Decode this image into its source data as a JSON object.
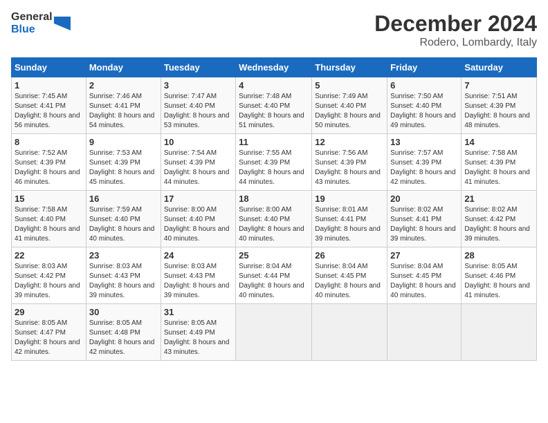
{
  "logo": {
    "line1": "General",
    "line2": "Blue"
  },
  "title": "December 2024",
  "location": "Rodero, Lombardy, Italy",
  "days_of_week": [
    "Sunday",
    "Monday",
    "Tuesday",
    "Wednesday",
    "Thursday",
    "Friday",
    "Saturday"
  ],
  "weeks": [
    [
      {
        "day": "1",
        "sunrise": "7:45 AM",
        "sunset": "4:41 PM",
        "daylight": "8 hours and 56 minutes."
      },
      {
        "day": "2",
        "sunrise": "7:46 AM",
        "sunset": "4:41 PM",
        "daylight": "8 hours and 54 minutes."
      },
      {
        "day": "3",
        "sunrise": "7:47 AM",
        "sunset": "4:40 PM",
        "daylight": "8 hours and 53 minutes."
      },
      {
        "day": "4",
        "sunrise": "7:48 AM",
        "sunset": "4:40 PM",
        "daylight": "8 hours and 51 minutes."
      },
      {
        "day": "5",
        "sunrise": "7:49 AM",
        "sunset": "4:40 PM",
        "daylight": "8 hours and 50 minutes."
      },
      {
        "day": "6",
        "sunrise": "7:50 AM",
        "sunset": "4:40 PM",
        "daylight": "8 hours and 49 minutes."
      },
      {
        "day": "7",
        "sunrise": "7:51 AM",
        "sunset": "4:39 PM",
        "daylight": "8 hours and 48 minutes."
      }
    ],
    [
      {
        "day": "8",
        "sunrise": "7:52 AM",
        "sunset": "4:39 PM",
        "daylight": "8 hours and 46 minutes."
      },
      {
        "day": "9",
        "sunrise": "7:53 AM",
        "sunset": "4:39 PM",
        "daylight": "8 hours and 45 minutes."
      },
      {
        "day": "10",
        "sunrise": "7:54 AM",
        "sunset": "4:39 PM",
        "daylight": "8 hours and 44 minutes."
      },
      {
        "day": "11",
        "sunrise": "7:55 AM",
        "sunset": "4:39 PM",
        "daylight": "8 hours and 44 minutes."
      },
      {
        "day": "12",
        "sunrise": "7:56 AM",
        "sunset": "4:39 PM",
        "daylight": "8 hours and 43 minutes."
      },
      {
        "day": "13",
        "sunrise": "7:57 AM",
        "sunset": "4:39 PM",
        "daylight": "8 hours and 42 minutes."
      },
      {
        "day": "14",
        "sunrise": "7:58 AM",
        "sunset": "4:39 PM",
        "daylight": "8 hours and 41 minutes."
      }
    ],
    [
      {
        "day": "15",
        "sunrise": "7:58 AM",
        "sunset": "4:40 PM",
        "daylight": "8 hours and 41 minutes."
      },
      {
        "day": "16",
        "sunrise": "7:59 AM",
        "sunset": "4:40 PM",
        "daylight": "8 hours and 40 minutes."
      },
      {
        "day": "17",
        "sunrise": "8:00 AM",
        "sunset": "4:40 PM",
        "daylight": "8 hours and 40 minutes."
      },
      {
        "day": "18",
        "sunrise": "8:00 AM",
        "sunset": "4:40 PM",
        "daylight": "8 hours and 40 minutes."
      },
      {
        "day": "19",
        "sunrise": "8:01 AM",
        "sunset": "4:41 PM",
        "daylight": "8 hours and 39 minutes."
      },
      {
        "day": "20",
        "sunrise": "8:02 AM",
        "sunset": "4:41 PM",
        "daylight": "8 hours and 39 minutes."
      },
      {
        "day": "21",
        "sunrise": "8:02 AM",
        "sunset": "4:42 PM",
        "daylight": "8 hours and 39 minutes."
      }
    ],
    [
      {
        "day": "22",
        "sunrise": "8:03 AM",
        "sunset": "4:42 PM",
        "daylight": "8 hours and 39 minutes."
      },
      {
        "day": "23",
        "sunrise": "8:03 AM",
        "sunset": "4:43 PM",
        "daylight": "8 hours and 39 minutes."
      },
      {
        "day": "24",
        "sunrise": "8:03 AM",
        "sunset": "4:43 PM",
        "daylight": "8 hours and 39 minutes."
      },
      {
        "day": "25",
        "sunrise": "8:04 AM",
        "sunset": "4:44 PM",
        "daylight": "8 hours and 40 minutes."
      },
      {
        "day": "26",
        "sunrise": "8:04 AM",
        "sunset": "4:45 PM",
        "daylight": "8 hours and 40 minutes."
      },
      {
        "day": "27",
        "sunrise": "8:04 AM",
        "sunset": "4:45 PM",
        "daylight": "8 hours and 40 minutes."
      },
      {
        "day": "28",
        "sunrise": "8:05 AM",
        "sunset": "4:46 PM",
        "daylight": "8 hours and 41 minutes."
      }
    ],
    [
      {
        "day": "29",
        "sunrise": "8:05 AM",
        "sunset": "4:47 PM",
        "daylight": "8 hours and 42 minutes."
      },
      {
        "day": "30",
        "sunrise": "8:05 AM",
        "sunset": "4:48 PM",
        "daylight": "8 hours and 42 minutes."
      },
      {
        "day": "31",
        "sunrise": "8:05 AM",
        "sunset": "4:49 PM",
        "daylight": "8 hours and 43 minutes."
      },
      null,
      null,
      null,
      null
    ]
  ]
}
